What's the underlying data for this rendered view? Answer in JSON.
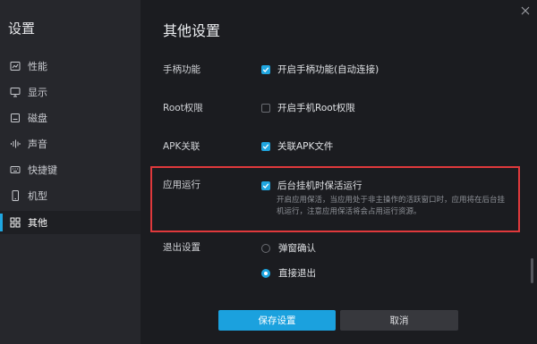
{
  "sidebar": {
    "title": "设置",
    "items": [
      {
        "label": "性能",
        "icon": "performance-icon"
      },
      {
        "label": "显示",
        "icon": "monitor-icon"
      },
      {
        "label": "磁盘",
        "icon": "disk-icon"
      },
      {
        "label": "声音",
        "icon": "sound-icon"
      },
      {
        "label": "快捷键",
        "icon": "keyboard-icon"
      },
      {
        "label": "机型",
        "icon": "phone-icon"
      },
      {
        "label": "其他",
        "icon": "grid-icon",
        "active": true
      }
    ]
  },
  "main": {
    "title": "其他设置",
    "gamepad": {
      "label": "手柄功能",
      "option": "开启手柄功能(自动连接)",
      "checked": true
    },
    "root": {
      "label": "Root权限",
      "option": "开启手机Root权限",
      "checked": false
    },
    "apk": {
      "label": "APK关联",
      "option": "关联APK文件",
      "checked": true
    },
    "app_run": {
      "label": "应用运行",
      "option": "后台挂机时保活运行",
      "checked": true,
      "description": "开启应用保活，当应用处于非主操作的活跃窗口时，应用将在后台挂机运行，注意应用保活将会占用运行资源。"
    },
    "exit": {
      "label": "退出设置",
      "options": [
        {
          "label": "弹窗确认",
          "selected": false
        },
        {
          "label": "直接退出",
          "selected": true
        }
      ]
    }
  },
  "footer": {
    "save_label": "保存设置",
    "cancel_label": "取消"
  },
  "colors": {
    "accent": "#1fa6e0",
    "highlight": "#e0393c",
    "background": "#1b1c20",
    "sidebar": "#26272c"
  }
}
